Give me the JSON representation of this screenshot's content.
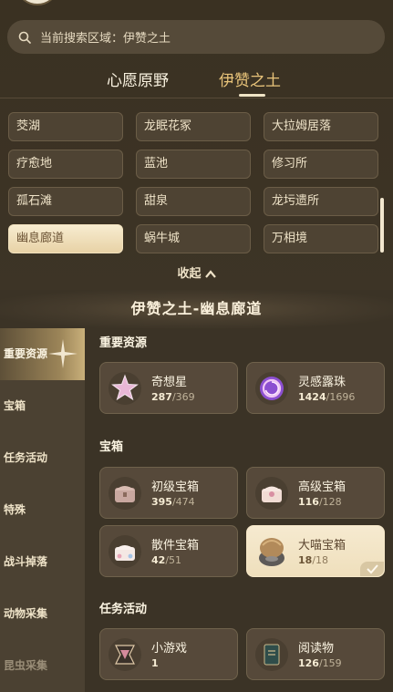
{
  "search": {
    "label": "当前搜索区域：伊赞之土"
  },
  "tabs": [
    {
      "label": "心愿原野"
    },
    {
      "label": "伊赞之土"
    }
  ],
  "areas": [
    "茭湖",
    "龙眠花冢",
    "大拉姆居落",
    "疗愈地",
    "蓝池",
    "修习所",
    "孤石滩",
    "甜泉",
    "龙圬遗所",
    "幽息廊道",
    "蜗牛城",
    "万相境"
  ],
  "selected_area": "幽息廊道",
  "collapse_label": "收起",
  "region_title": "伊赞之土-幽息廊道",
  "sidebar": {
    "items": [
      "重要资源",
      "宝箱",
      "任务活动",
      "特殊",
      "战斗掉落",
      "动物采集",
      "昆虫采集"
    ]
  },
  "sections": {
    "important": {
      "title": "重要资源",
      "items": [
        {
          "name": "奇想星",
          "current": "287",
          "total": "/369",
          "icon": "star-icon"
        },
        {
          "name": "灵感露珠",
          "current": "1424",
          "total": "/1696",
          "icon": "dewdrop-icon"
        }
      ]
    },
    "chests": {
      "title": "宝箱",
      "items": [
        {
          "name": "初级宝箱",
          "current": "395",
          "total": "/474",
          "icon": "chest-icon"
        },
        {
          "name": "高级宝箱",
          "current": "116",
          "total": "/128",
          "icon": "chest-icon"
        },
        {
          "name": "散件宝箱",
          "current": "42",
          "total": "/51",
          "icon": "chest-icon"
        },
        {
          "name": "大喵宝箱",
          "current": "18",
          "total": "/18",
          "icon": "cat-chest-icon"
        }
      ]
    },
    "quests": {
      "title": "任务活动",
      "items": [
        {
          "name": "小游戏",
          "current": "1",
          "total": "",
          "icon": "minigame-icon"
        },
        {
          "name": "阅读物",
          "current": "126",
          "total": "/159",
          "icon": "book-icon"
        }
      ]
    }
  },
  "colors": {
    "background": "#3b3326",
    "accent": "#e9c47a",
    "card": "#56493a",
    "highlight_card": "#f6ead0"
  }
}
